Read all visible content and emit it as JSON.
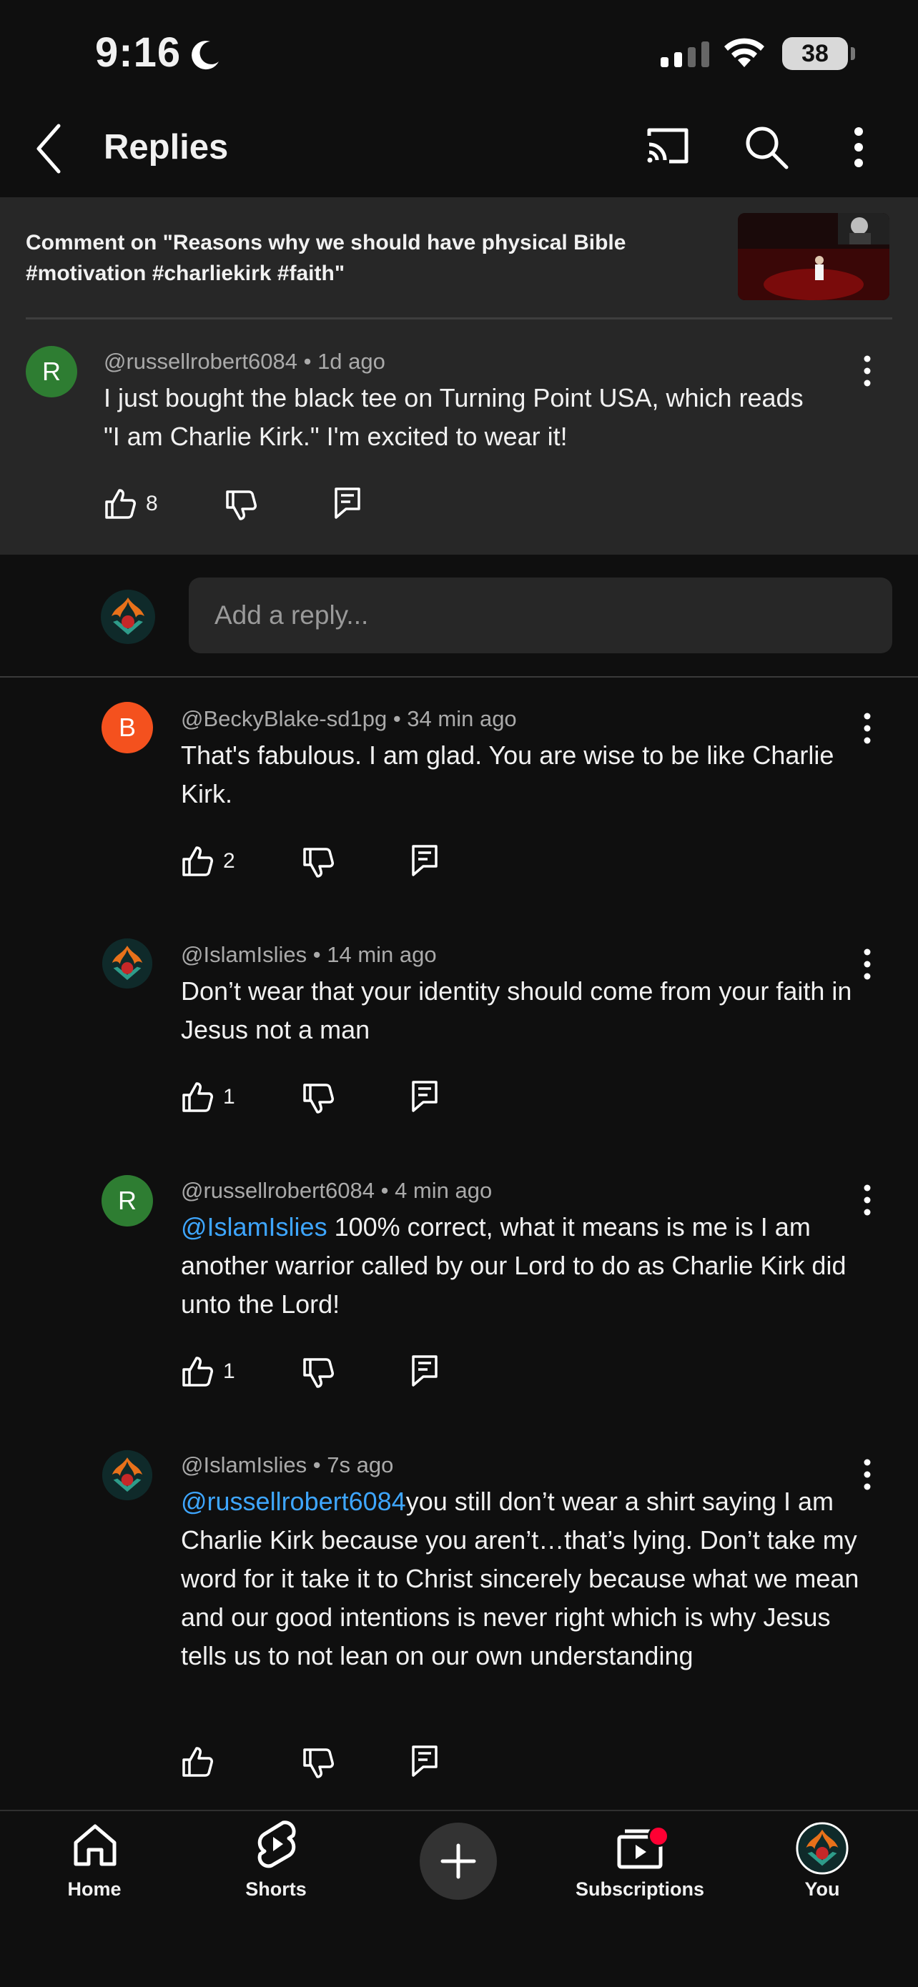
{
  "status_bar": {
    "time": "9:16",
    "battery": "38"
  },
  "header": {
    "title": "Replies"
  },
  "context": {
    "text": "Comment on \"Reasons why we should have physical Bible #motivation #charliekirk #faith\""
  },
  "parent_comment": {
    "avatar_letter": "R",
    "avatar_color": "#2e7d32",
    "meta": "@russellrobert6084 • 1d ago",
    "text": "I just bought the black tee on Turning Point USA, which reads \"I am Charlie Kirk.\" I'm excited to wear it!",
    "likes": "8"
  },
  "reply_box": {
    "placeholder": "Add a reply..."
  },
  "replies": [
    {
      "avatar_letter": "B",
      "avatar_color": "#f4511e",
      "meta": "@BeckyBlake-sd1pg • 34 min ago",
      "mention": "",
      "text": "That's fabulous.  I am glad. You  are wise to be like Charlie Kirk.",
      "likes": "2"
    },
    {
      "avatar_letter": "",
      "avatar_color": "#0f2a2a",
      "meta": "@IslamIslies • 14 min ago",
      "mention": "",
      "text": "Don’t wear that your identity should come from your faith in Jesus not a man",
      "likes": "1"
    },
    {
      "avatar_letter": "R",
      "avatar_color": "#2e7d32",
      "meta": "@russellrobert6084 • 4 min ago",
      "mention": "@IslamIslies",
      "text": " 100% correct, what it means is me is I am another warrior called by our Lord to do as Charlie Kirk did unto the Lord!",
      "likes": "1"
    },
    {
      "avatar_letter": "",
      "avatar_color": "#0f2a2a",
      "meta": "@IslamIslies • 7s ago",
      "mention": "@russellrobert6084",
      "text": "you still don’t wear a shirt saying I am Charlie Kirk because you aren’t…that’s lying. Don’t take my word for it take it to Christ sincerely because what we mean and our good intentions is never right which is why Jesus tells us to not lean on our own understanding",
      "likes": ""
    }
  ],
  "bottom_nav": {
    "home": "Home",
    "shorts": "Shorts",
    "subscriptions": "Subscriptions",
    "you": "You"
  }
}
